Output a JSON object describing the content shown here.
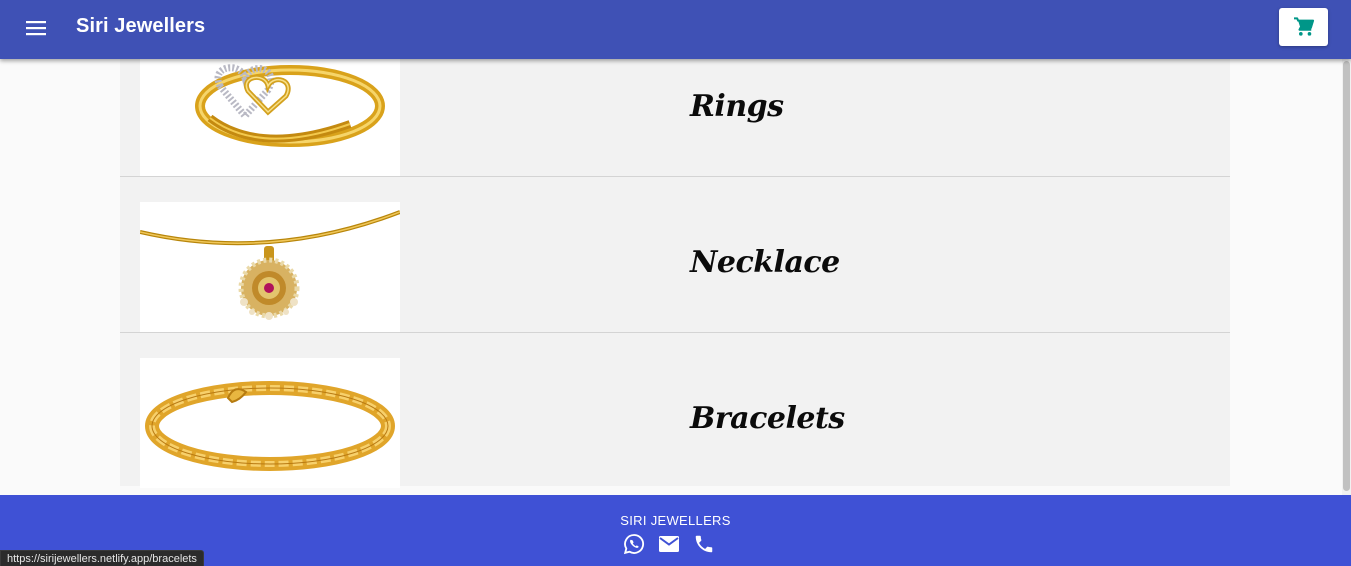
{
  "appbar": {
    "title": "Siri Jewellers",
    "background": "#3f51b5",
    "cart_icon_color": "#009688"
  },
  "categories": [
    {
      "label": "Rings",
      "image": "ring-image"
    },
    {
      "label": "Necklace",
      "image": "necklace-image"
    },
    {
      "label": "Bracelets",
      "image": "bracelet-image"
    }
  ],
  "footer": {
    "brand": "SIRI JEWELLERS",
    "icons": [
      "whatsapp-icon",
      "mail-icon",
      "phone-icon"
    ],
    "background": "#3f51d5"
  },
  "status_bar": {
    "url": "https://sirijewellers.netlify.app/bracelets"
  }
}
